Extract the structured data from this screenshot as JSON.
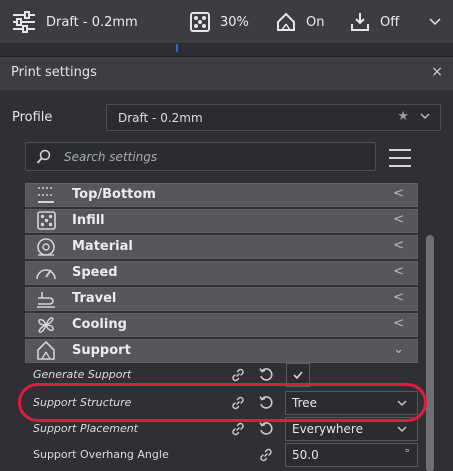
{
  "toolbar": {
    "profile_label": "Draft - 0.2mm",
    "infill_label": "30%",
    "support_label": "On",
    "adhesion_label": "Off"
  },
  "dialog": {
    "title": "Print settings",
    "close_glyph": "×",
    "profile_label": "Profile",
    "profile_value": "Draft - 0.2mm",
    "search_placeholder": "Search settings"
  },
  "categories": [
    {
      "label": "Top/Bottom",
      "icon": "top-bottom-icon",
      "arrow": "<"
    },
    {
      "label": "Infill",
      "icon": "infill-icon",
      "arrow": "<"
    },
    {
      "label": "Material",
      "icon": "material-icon",
      "arrow": "<"
    },
    {
      "label": "Speed",
      "icon": "speed-icon",
      "arrow": "<"
    },
    {
      "label": "Travel",
      "icon": "travel-icon",
      "arrow": "<"
    },
    {
      "label": "Cooling",
      "icon": "cooling-icon",
      "arrow": "<"
    },
    {
      "label": "Support",
      "icon": "support-icon",
      "arrow": "⌄"
    }
  ],
  "settings": {
    "generate_support": {
      "label": "Generate Support",
      "checked": true
    },
    "support_structure": {
      "label": "Support Structure",
      "value": "Tree"
    },
    "support_placement": {
      "label": "Support Placement",
      "value": "Everywhere"
    },
    "support_overhang_angle": {
      "label": "Support Overhang Angle",
      "value": "50.0",
      "unit": "°"
    }
  },
  "colors": {
    "accent": "#196fd6",
    "highlight": "#e01b3c",
    "category_bg": "#55575c",
    "panel_bg": "#2e3035"
  }
}
